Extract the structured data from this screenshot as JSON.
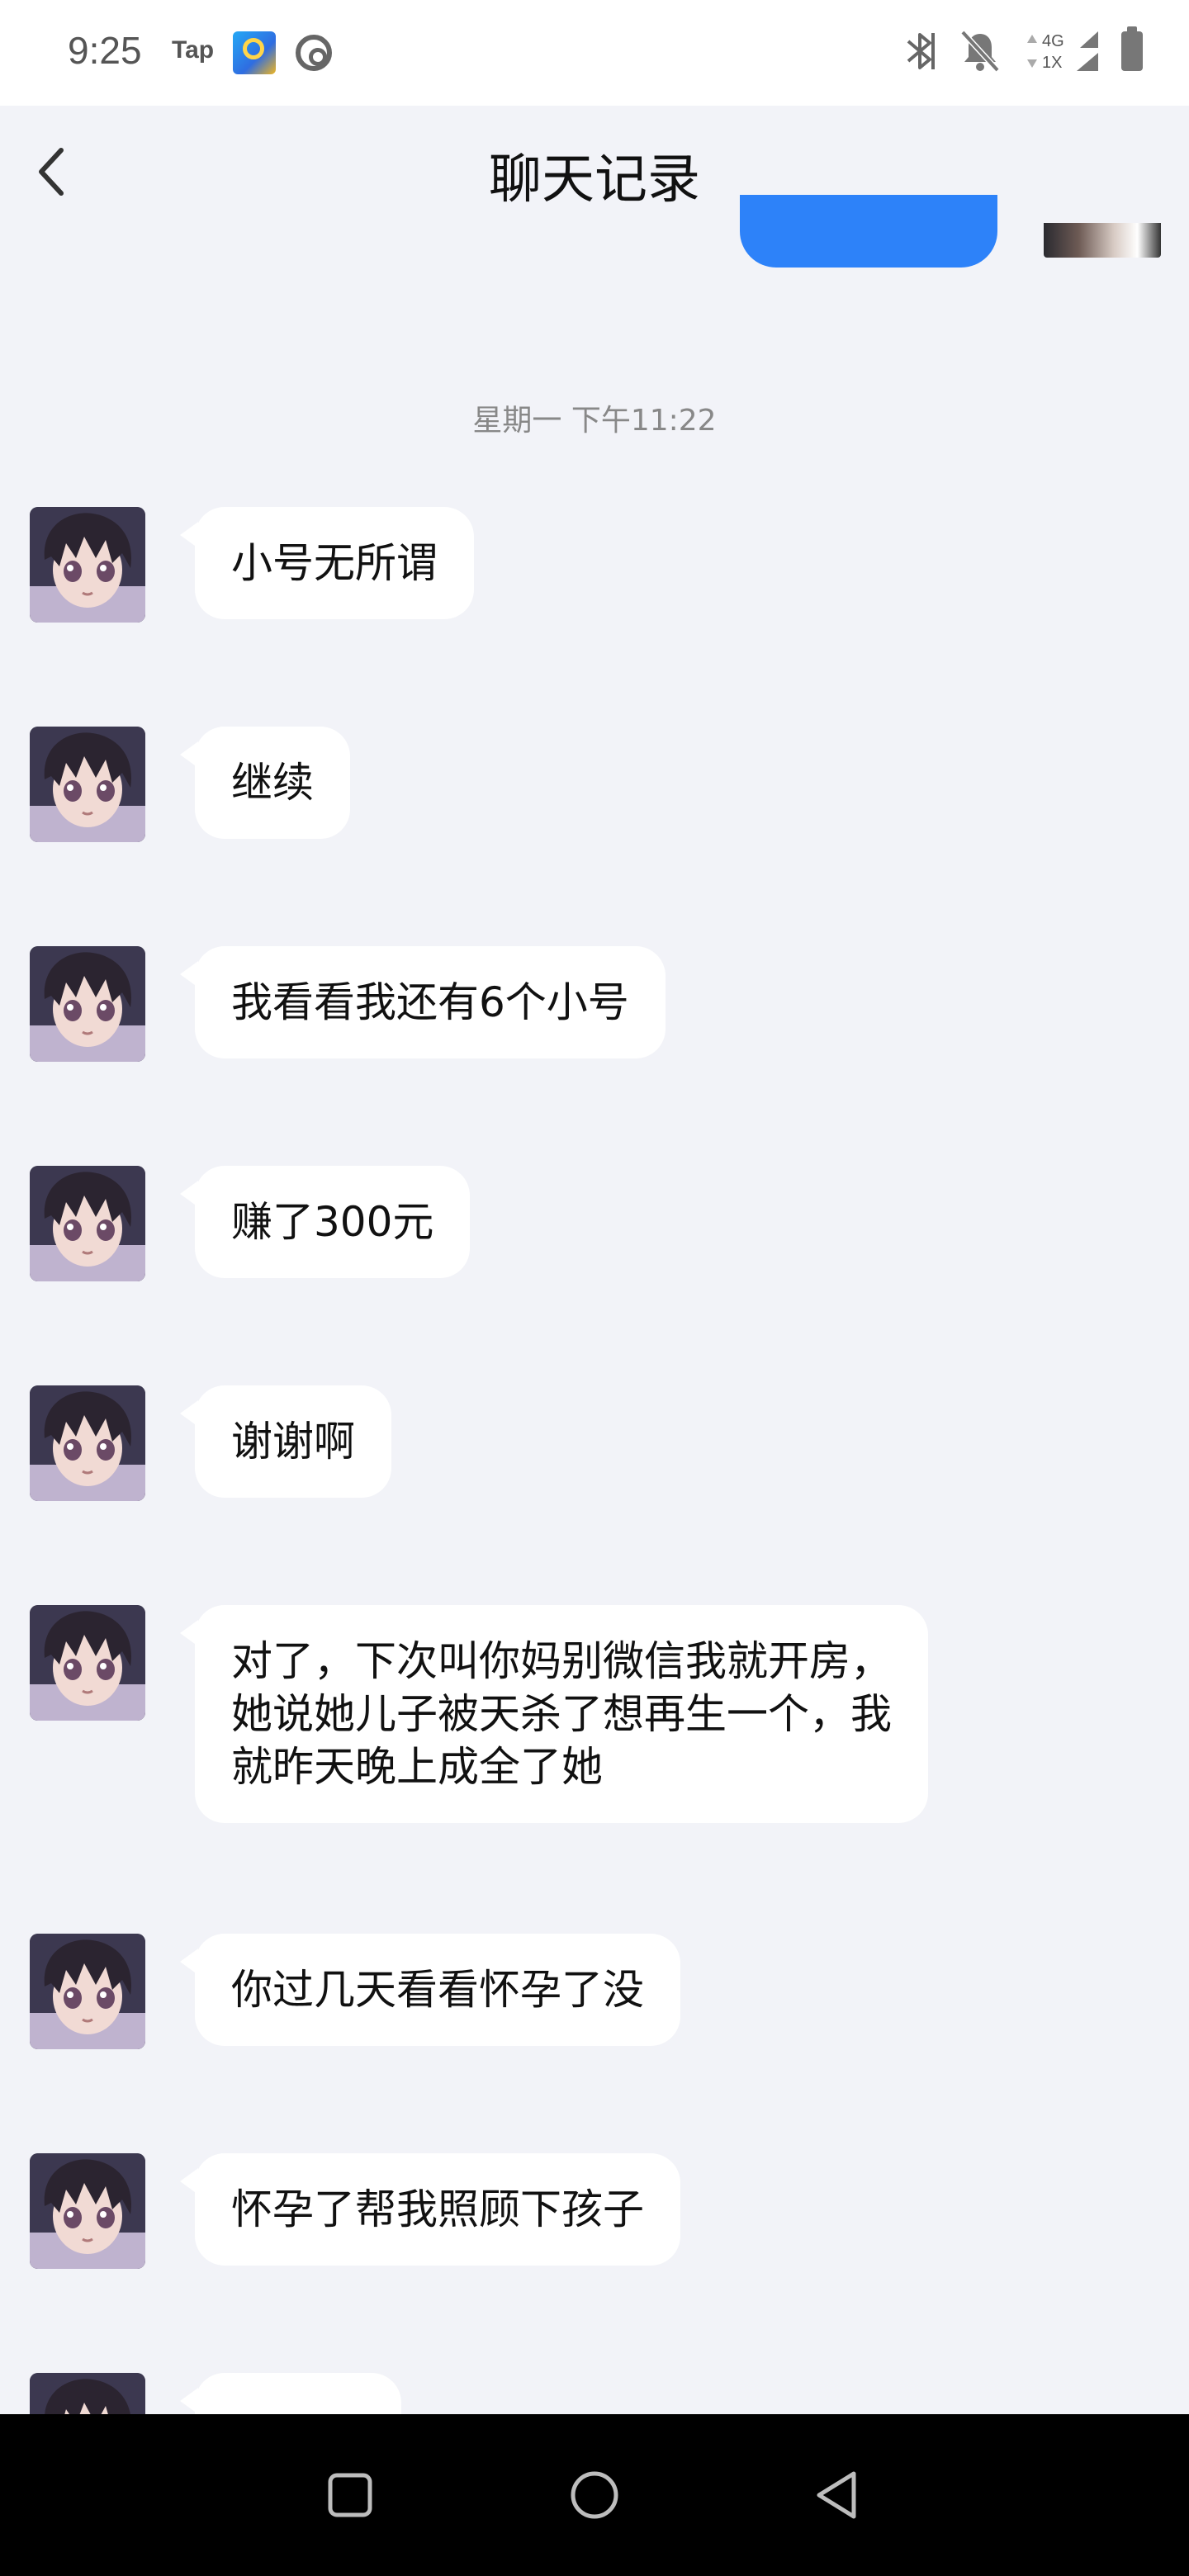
{
  "status_bar": {
    "time": "9:25",
    "tap_label": "Tap",
    "icons": [
      "app-2020-icon",
      "music-icon",
      "bluetooth-icon",
      "mute-icon",
      "signal-4g-1x-icon",
      "battery-icon"
    ],
    "network_top": "4G",
    "network_bottom": "1X"
  },
  "header": {
    "title": "聊天记录",
    "back_icon": "chevron-left-icon"
  },
  "chat": {
    "timestamp": "星期一 下午11:22",
    "messages": [
      {
        "text": "小号无所谓"
      },
      {
        "text": "继续"
      },
      {
        "text": "我看看我还有6个小号"
      },
      {
        "text": "赚了300元"
      },
      {
        "text": "谢谢啊"
      },
      {
        "text": "对了，下次叫你妈别微信我就开房，\n她说她儿子被天杀了想再生一个，我\n就昨天晚上成全了她"
      },
      {
        "text": "你过几天看看怀孕了没"
      },
      {
        "text": "怀孕了帮我照顾下孩子"
      }
    ]
  },
  "colors": {
    "background": "#f2f3f8",
    "bubble": "#ffffff",
    "accent_blue": "#2d82f9"
  },
  "nav_bar": {
    "icons": [
      "recents-square-icon",
      "home-circle-icon",
      "back-triangle-icon"
    ]
  }
}
